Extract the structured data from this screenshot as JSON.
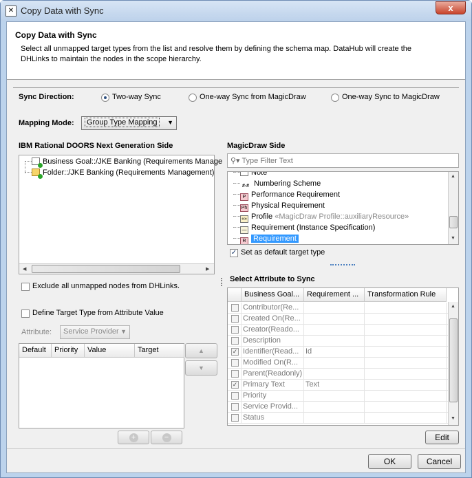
{
  "window": {
    "title": "Copy Data with Sync",
    "close_label": "x"
  },
  "header": {
    "title": "Copy Data with Sync",
    "description": "Select all unmapped target types from the list and resolve them by defining the schema map. DataHub will create the DHLinks to maintain the nodes in the scope hierarchy."
  },
  "sync": {
    "label": "Sync Direction:",
    "options": [
      "Two-way Sync",
      "One-way Sync from MagicDraw",
      "One-way Sync to MagicDraw"
    ],
    "selected": "Two-way Sync"
  },
  "mapping": {
    "label": "Mapping Mode:",
    "value": "Group Type Mapping"
  },
  "left": {
    "title": "IBM Rational DOORS Next Generation Side",
    "tree": [
      "Business Goal::/JKE Banking (Requirements Manage",
      "Folder::/JKE Banking (Requirements Management)"
    ],
    "exclude_label": "Exclude all unmapped nodes from DHLinks.",
    "define_label": "Define Target Type from Attribute Value",
    "attribute_label": "Attribute:",
    "attribute_value": "Service Provider",
    "columns": [
      "Default",
      "Priority",
      "Value",
      "Target"
    ]
  },
  "right": {
    "title": "MagicDraw Side",
    "filter_placeholder": "Type Filter Text",
    "types": [
      {
        "icon": "note-icon",
        "glyph": "",
        "label": "Note"
      },
      {
        "icon": "numbering-icon",
        "glyph": "#-#",
        "label": "Numbering Scheme"
      },
      {
        "icon": "performance-req-icon",
        "glyph": "P",
        "label": "Performance Requirement"
      },
      {
        "icon": "physical-req-icon",
        "glyph": "Ph",
        "label": "Physical Requirement"
      },
      {
        "icon": "profile-icon",
        "glyph": "«»",
        "label": "Profile",
        "note": "«MagicDraw Profile::auxiliaryResource»"
      },
      {
        "icon": "instance-spec-icon",
        "glyph": "—",
        "label": "Requirement (Instance Specification)"
      },
      {
        "icon": "requirement-icon",
        "glyph": "R",
        "label": "Requirement"
      }
    ],
    "default_label": "Set as default target type",
    "attr_title": "Select Attribute to Sync",
    "attr_columns": [
      "Business Goal...",
      "Requirement ...",
      "Transformation Rule"
    ],
    "attr_rows": [
      {
        "name": "Contributor(Re...",
        "req": "",
        "checked": false
      },
      {
        "name": "Created On(Re...",
        "req": "",
        "checked": false
      },
      {
        "name": "Creator(Reado...",
        "req": "",
        "checked": false
      },
      {
        "name": "Description",
        "req": "",
        "checked": false
      },
      {
        "name": "Identifier(Read...",
        "req": "Id",
        "checked": true
      },
      {
        "name": "Modified On(R...",
        "req": "",
        "checked": false
      },
      {
        "name": "Parent(Readonly)",
        "req": "",
        "checked": false
      },
      {
        "name": "Primary Text",
        "req": "Text",
        "checked": true
      },
      {
        "name": "Priority",
        "req": "",
        "checked": false
      },
      {
        "name": "Service Provid...",
        "req": "",
        "checked": false
      },
      {
        "name": "Status",
        "req": "",
        "checked": false
      }
    ],
    "edit_label": "Edit"
  },
  "footer": {
    "ok_label": "OK",
    "cancel_label": "Cancel"
  }
}
